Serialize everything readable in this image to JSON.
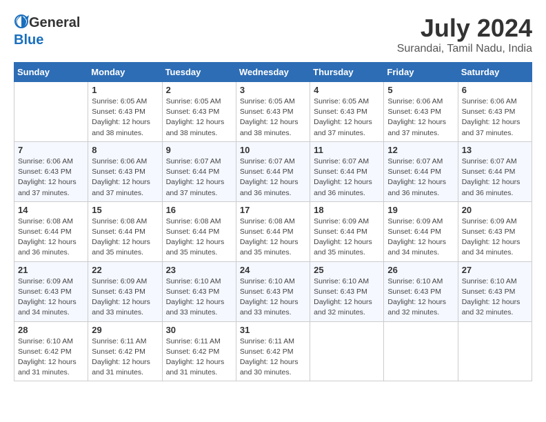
{
  "header": {
    "logo_general": "General",
    "logo_blue": "Blue",
    "month_year": "July 2024",
    "location": "Surandai, Tamil Nadu, India"
  },
  "weekdays": [
    "Sunday",
    "Monday",
    "Tuesday",
    "Wednesday",
    "Thursday",
    "Friday",
    "Saturday"
  ],
  "weeks": [
    [
      {
        "day": "",
        "sunrise": "",
        "sunset": "",
        "daylight": ""
      },
      {
        "day": "1",
        "sunrise": "Sunrise: 6:05 AM",
        "sunset": "Sunset: 6:43 PM",
        "daylight": "Daylight: 12 hours and 38 minutes."
      },
      {
        "day": "2",
        "sunrise": "Sunrise: 6:05 AM",
        "sunset": "Sunset: 6:43 PM",
        "daylight": "Daylight: 12 hours and 38 minutes."
      },
      {
        "day": "3",
        "sunrise": "Sunrise: 6:05 AM",
        "sunset": "Sunset: 6:43 PM",
        "daylight": "Daylight: 12 hours and 38 minutes."
      },
      {
        "day": "4",
        "sunrise": "Sunrise: 6:05 AM",
        "sunset": "Sunset: 6:43 PM",
        "daylight": "Daylight: 12 hours and 37 minutes."
      },
      {
        "day": "5",
        "sunrise": "Sunrise: 6:06 AM",
        "sunset": "Sunset: 6:43 PM",
        "daylight": "Daylight: 12 hours and 37 minutes."
      },
      {
        "day": "6",
        "sunrise": "Sunrise: 6:06 AM",
        "sunset": "Sunset: 6:43 PM",
        "daylight": "Daylight: 12 hours and 37 minutes."
      }
    ],
    [
      {
        "day": "7",
        "sunrise": "Sunrise: 6:06 AM",
        "sunset": "Sunset: 6:43 PM",
        "daylight": "Daylight: 12 hours and 37 minutes."
      },
      {
        "day": "8",
        "sunrise": "Sunrise: 6:06 AM",
        "sunset": "Sunset: 6:43 PM",
        "daylight": "Daylight: 12 hours and 37 minutes."
      },
      {
        "day": "9",
        "sunrise": "Sunrise: 6:07 AM",
        "sunset": "Sunset: 6:44 PM",
        "daylight": "Daylight: 12 hours and 37 minutes."
      },
      {
        "day": "10",
        "sunrise": "Sunrise: 6:07 AM",
        "sunset": "Sunset: 6:44 PM",
        "daylight": "Daylight: 12 hours and 36 minutes."
      },
      {
        "day": "11",
        "sunrise": "Sunrise: 6:07 AM",
        "sunset": "Sunset: 6:44 PM",
        "daylight": "Daylight: 12 hours and 36 minutes."
      },
      {
        "day": "12",
        "sunrise": "Sunrise: 6:07 AM",
        "sunset": "Sunset: 6:44 PM",
        "daylight": "Daylight: 12 hours and 36 minutes."
      },
      {
        "day": "13",
        "sunrise": "Sunrise: 6:07 AM",
        "sunset": "Sunset: 6:44 PM",
        "daylight": "Daylight: 12 hours and 36 minutes."
      }
    ],
    [
      {
        "day": "14",
        "sunrise": "Sunrise: 6:08 AM",
        "sunset": "Sunset: 6:44 PM",
        "daylight": "Daylight: 12 hours and 36 minutes."
      },
      {
        "day": "15",
        "sunrise": "Sunrise: 6:08 AM",
        "sunset": "Sunset: 6:44 PM",
        "daylight": "Daylight: 12 hours and 35 minutes."
      },
      {
        "day": "16",
        "sunrise": "Sunrise: 6:08 AM",
        "sunset": "Sunset: 6:44 PM",
        "daylight": "Daylight: 12 hours and 35 minutes."
      },
      {
        "day": "17",
        "sunrise": "Sunrise: 6:08 AM",
        "sunset": "Sunset: 6:44 PM",
        "daylight": "Daylight: 12 hours and 35 minutes."
      },
      {
        "day": "18",
        "sunrise": "Sunrise: 6:09 AM",
        "sunset": "Sunset: 6:44 PM",
        "daylight": "Daylight: 12 hours and 35 minutes."
      },
      {
        "day": "19",
        "sunrise": "Sunrise: 6:09 AM",
        "sunset": "Sunset: 6:44 PM",
        "daylight": "Daylight: 12 hours and 34 minutes."
      },
      {
        "day": "20",
        "sunrise": "Sunrise: 6:09 AM",
        "sunset": "Sunset: 6:43 PM",
        "daylight": "Daylight: 12 hours and 34 minutes."
      }
    ],
    [
      {
        "day": "21",
        "sunrise": "Sunrise: 6:09 AM",
        "sunset": "Sunset: 6:43 PM",
        "daylight": "Daylight: 12 hours and 34 minutes."
      },
      {
        "day": "22",
        "sunrise": "Sunrise: 6:09 AM",
        "sunset": "Sunset: 6:43 PM",
        "daylight": "Daylight: 12 hours and 33 minutes."
      },
      {
        "day": "23",
        "sunrise": "Sunrise: 6:10 AM",
        "sunset": "Sunset: 6:43 PM",
        "daylight": "Daylight: 12 hours and 33 minutes."
      },
      {
        "day": "24",
        "sunrise": "Sunrise: 6:10 AM",
        "sunset": "Sunset: 6:43 PM",
        "daylight": "Daylight: 12 hours and 33 minutes."
      },
      {
        "day": "25",
        "sunrise": "Sunrise: 6:10 AM",
        "sunset": "Sunset: 6:43 PM",
        "daylight": "Daylight: 12 hours and 32 minutes."
      },
      {
        "day": "26",
        "sunrise": "Sunrise: 6:10 AM",
        "sunset": "Sunset: 6:43 PM",
        "daylight": "Daylight: 12 hours and 32 minutes."
      },
      {
        "day": "27",
        "sunrise": "Sunrise: 6:10 AM",
        "sunset": "Sunset: 6:43 PM",
        "daylight": "Daylight: 12 hours and 32 minutes."
      }
    ],
    [
      {
        "day": "28",
        "sunrise": "Sunrise: 6:10 AM",
        "sunset": "Sunset: 6:42 PM",
        "daylight": "Daylight: 12 hours and 31 minutes."
      },
      {
        "day": "29",
        "sunrise": "Sunrise: 6:11 AM",
        "sunset": "Sunset: 6:42 PM",
        "daylight": "Daylight: 12 hours and 31 minutes."
      },
      {
        "day": "30",
        "sunrise": "Sunrise: 6:11 AM",
        "sunset": "Sunset: 6:42 PM",
        "daylight": "Daylight: 12 hours and 31 minutes."
      },
      {
        "day": "31",
        "sunrise": "Sunrise: 6:11 AM",
        "sunset": "Sunset: 6:42 PM",
        "daylight": "Daylight: 12 hours and 30 minutes."
      },
      {
        "day": "",
        "sunrise": "",
        "sunset": "",
        "daylight": ""
      },
      {
        "day": "",
        "sunrise": "",
        "sunset": "",
        "daylight": ""
      },
      {
        "day": "",
        "sunrise": "",
        "sunset": "",
        "daylight": ""
      }
    ]
  ]
}
